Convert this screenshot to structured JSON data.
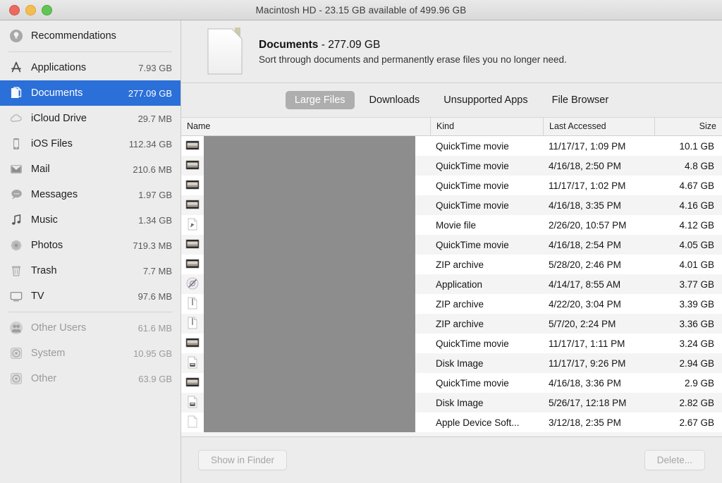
{
  "window": {
    "title": "Macintosh HD - 23.15 GB available of 499.96 GB",
    "accent_blue": "#2b6fd8",
    "traffic_lights": {
      "close": "close-button",
      "minimize": "minimize-button",
      "maximize": "maximize-button"
    }
  },
  "sidebar": {
    "groups": [
      {
        "items": [
          {
            "label": "Recommendations",
            "size": "",
            "icon": "lightbulb-icon",
            "selected": false,
            "dim": false
          }
        ]
      },
      {
        "items": [
          {
            "label": "Applications",
            "size": "7.93 GB",
            "icon": "app-store-icon",
            "selected": false,
            "dim": false
          },
          {
            "label": "Documents",
            "size": "277.09 GB",
            "icon": "documents-icon",
            "selected": true,
            "dim": false
          },
          {
            "label": "iCloud Drive",
            "size": "29.7 MB",
            "icon": "icloud-icon",
            "selected": false,
            "dim": false
          },
          {
            "label": "iOS Files",
            "size": "112.34 GB",
            "icon": "iphone-icon",
            "selected": false,
            "dim": false
          },
          {
            "label": "Mail",
            "size": "210.6 MB",
            "icon": "mail-icon",
            "selected": false,
            "dim": false
          },
          {
            "label": "Messages",
            "size": "1.97 GB",
            "icon": "messages-icon",
            "selected": false,
            "dim": false
          },
          {
            "label": "Music",
            "size": "1.34 GB",
            "icon": "music-note-icon",
            "selected": false,
            "dim": false
          },
          {
            "label": "Photos",
            "size": "719.3 MB",
            "icon": "photos-icon",
            "selected": false,
            "dim": false
          },
          {
            "label": "Trash",
            "size": "7.7 MB",
            "icon": "trash-icon",
            "selected": false,
            "dim": false
          },
          {
            "label": "TV",
            "size": "97.6 MB",
            "icon": "tv-icon",
            "selected": false,
            "dim": false
          }
        ]
      },
      {
        "items": [
          {
            "label": "Other Users",
            "size": "61.6 MB",
            "icon": "users-icon",
            "selected": false,
            "dim": true
          },
          {
            "label": "System",
            "size": "10.95 GB",
            "icon": "disk-icon",
            "selected": false,
            "dim": true
          },
          {
            "label": "Other",
            "size": "63.9 GB",
            "icon": "disk-icon",
            "selected": false,
            "dim": true
          }
        ]
      }
    ]
  },
  "header": {
    "icon": "document-file-icon",
    "title_name": "Documents",
    "title_separator": " - ",
    "title_size": "277.09 GB",
    "subtitle": "Sort through documents and permanently erase files you no longer need."
  },
  "tabs": [
    {
      "label": "Large Files",
      "active": true
    },
    {
      "label": "Downloads",
      "active": false
    },
    {
      "label": "Unsupported Apps",
      "active": false
    },
    {
      "label": "File Browser",
      "active": false
    }
  ],
  "table": {
    "columns": [
      "Name",
      "Kind",
      "Last Accessed",
      "Size"
    ],
    "name_redacted": true,
    "rows": [
      {
        "name": "",
        "icon": "movie-thumbnail-icon",
        "kind": "QuickTime movie",
        "last_accessed": "11/17/17, 1:09 PM",
        "size": "10.1 GB"
      },
      {
        "name": "",
        "icon": "movie-thumbnail-icon",
        "kind": "QuickTime movie",
        "last_accessed": "4/16/18, 2:50 PM",
        "size": "4.8 GB"
      },
      {
        "name": "",
        "icon": "movie-thumbnail-icon",
        "kind": "QuickTime movie",
        "last_accessed": "11/17/17, 1:02 PM",
        "size": "4.67 GB"
      },
      {
        "name": "",
        "icon": "movie-thumbnail-icon",
        "kind": "QuickTime movie",
        "last_accessed": "4/16/18, 3:35 PM",
        "size": "4.16 GB"
      },
      {
        "name": "",
        "icon": "movie-file-icon",
        "kind": "Movie file",
        "last_accessed": "2/26/20, 10:57 PM",
        "size": "4.12 GB"
      },
      {
        "name": "",
        "icon": "movie-thumbnail-icon",
        "kind": "QuickTime movie",
        "last_accessed": "4/16/18, 2:54 PM",
        "size": "4.05 GB"
      },
      {
        "name": "",
        "icon": "movie-thumbnail-icon",
        "kind": "ZIP archive",
        "last_accessed": "5/28/20, 2:46 PM",
        "size": "4.01 GB"
      },
      {
        "name": "",
        "icon": "application-icon",
        "kind": "Application",
        "last_accessed": "4/14/17, 8:55 AM",
        "size": "3.77 GB"
      },
      {
        "name": "",
        "icon": "zip-archive-icon",
        "kind": "ZIP archive",
        "last_accessed": "4/22/20, 3:04 PM",
        "size": "3.39 GB"
      },
      {
        "name": "",
        "icon": "zip-archive-icon",
        "kind": "ZIP archive",
        "last_accessed": "5/7/20, 2:24 PM",
        "size": "3.36 GB"
      },
      {
        "name": "",
        "icon": "movie-thumbnail-icon",
        "kind": "QuickTime movie",
        "last_accessed": "11/17/17, 1:11 PM",
        "size": "3.24 GB"
      },
      {
        "name": "",
        "icon": "disk-image-icon",
        "kind": "Disk Image",
        "last_accessed": "11/17/17, 9:26 PM",
        "size": "2.94 GB"
      },
      {
        "name": "",
        "icon": "movie-thumbnail-icon",
        "kind": "QuickTime movie",
        "last_accessed": "4/16/18, 3:36 PM",
        "size": "2.9 GB"
      },
      {
        "name": "",
        "icon": "disk-image-icon",
        "kind": "Disk Image",
        "last_accessed": "5/26/17, 12:18 PM",
        "size": "2.82 GB"
      },
      {
        "name": "",
        "icon": "blank-document-icon",
        "kind": "Apple Device Soft...",
        "last_accessed": "3/12/18, 2:35 PM",
        "size": "2.67 GB"
      },
      {
        "name": "",
        "icon": "movie-thumbnail-icon",
        "kind": "",
        "last_accessed": "",
        "size": ""
      }
    ]
  },
  "footer": {
    "show_in_finder_label": "Show in Finder",
    "delete_label": "Delete...",
    "show_in_finder_enabled": false,
    "delete_enabled": false
  }
}
